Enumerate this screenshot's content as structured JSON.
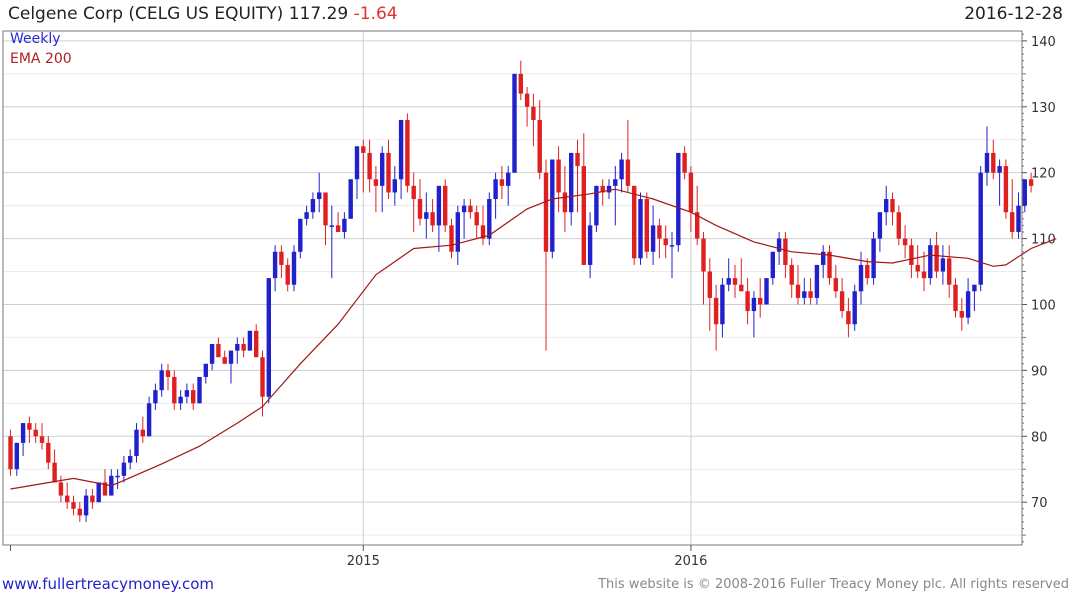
{
  "header": {
    "name": "Celgene Corp (CELG US EQUITY)",
    "price": "117.29",
    "change": "-1.64",
    "date": "2016-12-28"
  },
  "legend": {
    "weekly": "Weekly",
    "ema": "EMA 200"
  },
  "footer": {
    "site": "www.fullertreacymoney.com",
    "copyright": "This website is © 2008-2016 Fuller Treacy Money plc. All rights reserved"
  },
  "colors": {
    "up": "#2020cc",
    "down": "#e02020",
    "ema": "#a01818",
    "grid": "#d8d8d8"
  },
  "chart_data": {
    "type": "candlestick",
    "frequency": "weekly",
    "ylim": [
      63.5,
      141.5
    ],
    "y_ticks": [
      70,
      80,
      90,
      100,
      110,
      120,
      130,
      140
    ],
    "x_tick_labels": [
      {
        "label": "2015",
        "index": 56
      },
      {
        "label": "2016",
        "index": 108
      }
    ],
    "candles": [
      [
        80,
        81,
        74,
        75
      ],
      [
        75,
        79,
        74,
        79
      ],
      [
        79,
        82,
        77,
        82
      ],
      [
        82,
        83,
        79,
        81
      ],
      [
        81,
        82,
        79,
        80
      ],
      [
        80,
        82,
        78,
        79
      ],
      [
        79,
        80,
        75,
        76
      ],
      [
        76,
        78,
        73,
        73
      ],
      [
        73,
        74,
        70,
        71
      ],
      [
        71,
        73,
        69,
        70
      ],
      [
        70,
        71,
        68,
        69
      ],
      [
        69,
        70,
        67,
        68
      ],
      [
        68,
        72,
        67,
        71
      ],
      [
        71,
        72,
        69,
        70
      ],
      [
        70,
        73,
        70,
        73
      ],
      [
        73,
        75,
        71,
        71
      ],
      [
        71,
        75,
        71,
        74
      ],
      [
        74,
        75,
        72,
        74
      ],
      [
        74,
        77,
        73,
        76
      ],
      [
        76,
        78,
        75,
        77
      ],
      [
        77,
        82,
        76,
        81
      ],
      [
        81,
        83,
        79,
        80
      ],
      [
        80,
        86,
        80,
        85
      ],
      [
        85,
        88,
        84,
        87
      ],
      [
        87,
        91,
        86,
        90
      ],
      [
        90,
        91,
        87,
        89
      ],
      [
        89,
        90,
        84,
        85
      ],
      [
        85,
        87,
        84,
        86
      ],
      [
        86,
        88,
        85,
        87
      ],
      [
        87,
        88,
        84,
        85
      ],
      [
        85,
        89,
        85,
        89
      ],
      [
        89,
        91,
        88,
        91
      ],
      [
        91,
        94,
        90,
        94
      ],
      [
        94,
        95,
        92,
        92
      ],
      [
        92,
        93,
        91,
        91
      ],
      [
        91,
        93,
        88,
        93
      ],
      [
        93,
        95,
        91,
        94
      ],
      [
        94,
        95,
        92,
        93
      ],
      [
        93,
        96,
        93,
        96
      ],
      [
        96,
        97,
        92,
        92
      ],
      [
        92,
        93,
        83,
        86
      ],
      [
        86,
        104,
        85,
        104
      ],
      [
        104,
        109,
        102,
        108
      ],
      [
        108,
        109,
        104,
        106
      ],
      [
        106,
        107,
        102,
        103
      ],
      [
        103,
        109,
        102,
        108
      ],
      [
        108,
        113,
        107,
        113
      ],
      [
        113,
        115,
        112,
        114
      ],
      [
        114,
        117,
        113,
        116
      ],
      [
        116,
        120,
        114,
        117
      ],
      [
        117,
        117,
        109,
        112
      ],
      [
        112,
        115,
        104,
        112
      ],
      [
        112,
        114,
        111,
        111
      ],
      [
        111,
        114,
        110,
        113
      ],
      [
        113,
        119,
        113,
        119
      ],
      [
        119,
        124,
        116,
        124
      ],
      [
        124,
        125,
        117,
        123
      ],
      [
        123,
        125,
        117,
        119
      ],
      [
        119,
        121,
        114,
        118
      ],
      [
        118,
        124,
        114,
        123
      ],
      [
        123,
        125,
        116,
        117
      ],
      [
        117,
        121,
        115,
        119
      ],
      [
        119,
        128,
        116,
        128
      ],
      [
        128,
        129,
        117,
        118
      ],
      [
        118,
        120,
        111,
        116
      ],
      [
        116,
        119,
        112,
        113
      ],
      [
        113,
        117,
        110,
        114
      ],
      [
        114,
        116,
        111,
        112
      ],
      [
        112,
        118,
        108,
        118
      ],
      [
        118,
        119,
        111,
        112
      ],
      [
        112,
        113,
        107,
        108
      ],
      [
        108,
        115,
        106,
        114
      ],
      [
        114,
        116,
        110,
        115
      ],
      [
        115,
        116,
        113,
        114
      ],
      [
        114,
        115,
        110,
        112
      ],
      [
        112,
        115,
        109,
        110
      ],
      [
        110,
        117,
        109,
        116
      ],
      [
        116,
        120,
        113,
        119
      ],
      [
        119,
        121,
        116,
        118
      ],
      [
        118,
        121,
        115,
        120
      ],
      [
        120,
        135,
        120,
        135
      ],
      [
        135,
        137,
        131,
        132
      ],
      [
        132,
        133,
        127,
        130
      ],
      [
        130,
        132,
        124,
        128
      ],
      [
        128,
        131,
        119,
        120
      ],
      [
        120,
        122,
        93,
        108
      ],
      [
        108,
        122,
        107,
        122
      ],
      [
        122,
        124,
        114,
        117
      ],
      [
        117,
        121,
        111,
        114
      ],
      [
        114,
        123,
        112,
        123
      ],
      [
        123,
        125,
        114,
        121
      ],
      [
        121,
        126,
        106,
        106
      ],
      [
        106,
        114,
        104,
        112
      ],
      [
        112,
        118,
        111,
        118
      ],
      [
        118,
        119,
        115,
        117
      ],
      [
        117,
        119,
        116,
        118
      ],
      [
        118,
        121,
        112,
        119
      ],
      [
        119,
        123,
        117,
        122
      ],
      [
        122,
        128,
        117,
        118
      ],
      [
        118,
        118,
        106,
        107
      ],
      [
        107,
        117,
        106,
        116
      ],
      [
        116,
        117,
        107,
        108
      ],
      [
        108,
        115,
        106,
        112
      ],
      [
        112,
        113,
        107,
        110
      ],
      [
        110,
        112,
        107,
        109
      ],
      [
        109,
        111,
        104,
        109
      ],
      [
        109,
        123,
        108,
        123
      ],
      [
        123,
        124,
        119,
        120
      ],
      [
        120,
        121,
        111,
        114
      ],
      [
        114,
        118,
        109,
        110
      ],
      [
        110,
        111,
        100,
        105
      ],
      [
        105,
        107,
        96,
        101
      ],
      [
        101,
        103,
        93,
        97
      ],
      [
        97,
        104,
        95,
        103
      ],
      [
        103,
        107,
        102,
        104
      ],
      [
        104,
        106,
        101,
        103
      ],
      [
        103,
        107,
        102,
        102
      ],
      [
        102,
        104,
        97,
        99
      ],
      [
        99,
        102,
        95,
        101
      ],
      [
        101,
        104,
        98,
        100
      ],
      [
        100,
        104,
        100,
        104
      ],
      [
        104,
        108,
        103,
        108
      ],
      [
        108,
        111,
        106,
        110
      ],
      [
        110,
        111,
        104,
        106
      ],
      [
        106,
        107,
        101,
        103
      ],
      [
        103,
        106,
        100,
        101
      ],
      [
        101,
        104,
        100,
        102
      ],
      [
        102,
        104,
        100,
        101
      ],
      [
        101,
        106,
        100,
        106
      ],
      [
        106,
        109,
        104,
        108
      ],
      [
        108,
        109,
        103,
        104
      ],
      [
        104,
        106,
        101,
        102
      ],
      [
        102,
        104,
        98,
        99
      ],
      [
        99,
        101,
        95,
        97
      ],
      [
        97,
        103,
        96,
        102
      ],
      [
        102,
        108,
        100,
        106
      ],
      [
        106,
        107,
        103,
        104
      ],
      [
        104,
        111,
        103,
        110
      ],
      [
        110,
        114,
        108,
        114
      ],
      [
        114,
        118,
        112,
        116
      ],
      [
        116,
        117,
        112,
        114
      ],
      [
        114,
        115,
        109,
        110
      ],
      [
        110,
        112,
        107,
        109
      ],
      [
        109,
        110,
        104,
        106
      ],
      [
        106,
        109,
        104,
        105
      ],
      [
        105,
        108,
        102,
        104
      ],
      [
        104,
        110,
        103,
        109
      ],
      [
        109,
        111,
        104,
        105
      ],
      [
        105,
        109,
        103,
        107
      ],
      [
        107,
        109,
        101,
        103
      ],
      [
        103,
        104,
        98,
        99
      ],
      [
        99,
        101,
        96,
        98
      ],
      [
        98,
        104,
        97,
        102
      ],
      [
        102,
        103,
        99,
        103
      ],
      [
        103,
        121,
        102,
        120
      ],
      [
        120,
        127,
        118,
        123
      ],
      [
        123,
        125,
        119,
        120
      ],
      [
        120,
        122,
        115,
        121
      ],
      [
        121,
        122,
        113,
        114
      ],
      [
        114,
        119,
        110,
        111
      ],
      [
        111,
        117,
        110,
        115
      ],
      [
        115,
        119,
        114,
        119
      ],
      [
        119,
        120,
        117,
        118
      ]
    ],
    "ema": [
      [
        0,
        72
      ],
      [
        10,
        73.6
      ],
      [
        16,
        72.5
      ],
      [
        18,
        73.3
      ],
      [
        24,
        75.8
      ],
      [
        30,
        78.5
      ],
      [
        36,
        82
      ],
      [
        40,
        84.5
      ],
      [
        46,
        91
      ],
      [
        52,
        97
      ],
      [
        58,
        104.5
      ],
      [
        64,
        108.5
      ],
      [
        70,
        109
      ],
      [
        76,
        110.5
      ],
      [
        82,
        114.5
      ],
      [
        86,
        116
      ],
      [
        92,
        116.8
      ],
      [
        96,
        117.5
      ],
      [
        102,
        116
      ],
      [
        108,
        114
      ],
      [
        112,
        112
      ],
      [
        118,
        109.5
      ],
      [
        124,
        108
      ],
      [
        130,
        107.5
      ],
      [
        136,
        106.5
      ],
      [
        140,
        106.3
      ],
      [
        146,
        107.5
      ],
      [
        152,
        107
      ],
      [
        156,
        105.8
      ],
      [
        158,
        106
      ],
      [
        162,
        108.5
      ],
      [
        166,
        110
      ]
    ]
  }
}
